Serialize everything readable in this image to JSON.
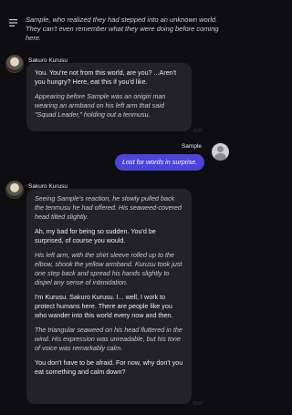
{
  "header": {
    "menu_icon": "hamburger-menu-icon",
    "intro": "Sample, who realized they had stepped into an unknown world. They can't even remember what they were doing before coming here."
  },
  "messages": [
    {
      "sender": "Sakuro Kurusu",
      "paragraphs": [
        {
          "text": "You. You're not from this world, are you? ...Aren't you hungry? Here, eat this if you'd like.",
          "italic": false
        },
        {
          "text": "Appearing before Sample was an onigiri man wearing an armband on his left arm that said \"Squad Leader,\" holding out a tenmusu.",
          "italic": true
        }
      ],
      "stamp": "0:00"
    },
    {
      "sender": "Sample",
      "text": "Lost for words in surprise."
    },
    {
      "sender": "Sakuro Kurusu",
      "paragraphs": [
        {
          "text": "Seeing Sample's reaction, he slowly pulled back the tenmusu he had offered. His seaweed-covered head tilted slightly.",
          "italic": true
        },
        {
          "text": "Ah, my bad for being so sudden. You'd be surprised, of course you would.",
          "italic": false
        },
        {
          "text": "His left arm, with the shirt sleeve rolled up to the elbow, shook the yellow armband. Kurusu took just one step back and spread his hands slightly to dispel any sense of intimidation.",
          "italic": true
        },
        {
          "text": "I'm Kurusu. Sakuro Kurusu. I... well, I work to protect humans here. There are people like you who wander into this world every now and then.",
          "italic": false
        },
        {
          "text": "The triangular seaweed on his head fluttered in the wind. His expression was unreadable, but his tone of voice was remarkably calm.",
          "italic": true
        },
        {
          "text": "You don't have to be afraid. For now, why don't you eat something and calm down?",
          "italic": false
        }
      ],
      "stamp": "0:00"
    }
  ]
}
